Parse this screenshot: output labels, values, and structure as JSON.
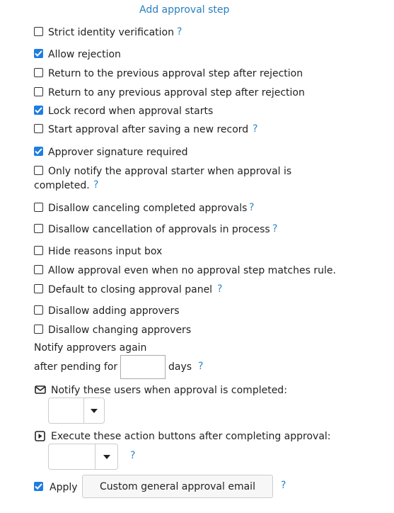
{
  "header": {
    "add_step_link": "Add approval step"
  },
  "options": [
    {
      "label": "Strict identity verification",
      "checked": false,
      "help": "?"
    },
    {
      "label": "Allow rejection",
      "checked": true
    },
    {
      "label": "Return to the previous approval step after rejection",
      "checked": false
    },
    {
      "label": "Return to any previous approval step after rejection",
      "checked": false
    },
    {
      "label": "Lock record when approval starts",
      "checked": true
    },
    {
      "label": "Start approval after saving a new record",
      "checked": false,
      "help": "?"
    },
    {
      "label": "Approver signature required",
      "checked": true
    },
    {
      "label_line1": "Only notify the approval starter when approval is",
      "label_line2": "completed.",
      "checked": false,
      "help": "?"
    },
    {
      "label": "Disallow canceling completed approvals",
      "checked": false,
      "help": "?"
    },
    {
      "label": "Disallow cancellation of approvals in process",
      "checked": false,
      "help": "?"
    },
    {
      "label": "Hide reasons input box",
      "checked": false
    },
    {
      "label": "Allow approval even when no approval step matches rule.",
      "checked": false
    },
    {
      "label": "Default to closing approval panel",
      "checked": false,
      "help": "?"
    },
    {
      "label": "Disallow adding approvers",
      "checked": false
    },
    {
      "label": "Disallow changing approvers",
      "checked": false
    }
  ],
  "notify_again": {
    "line1": "Notify approvers again",
    "prefix": "after pending for",
    "value": "",
    "suffix": "days",
    "help": "?"
  },
  "notify_users": {
    "icon": "envelope-icon",
    "label": "Notify these users when approval is completed:",
    "selected": ""
  },
  "execute_actions": {
    "icon": "play-icon",
    "label": "Execute these action buttons after completing approval:",
    "selected": "",
    "help": "?"
  },
  "apply": {
    "checked": true,
    "label": "Apply",
    "button_label": "Custom general approval email",
    "help": "?"
  },
  "colors": {
    "link": "#2a7fbf",
    "checkbox_checked": "#1f7de0"
  }
}
